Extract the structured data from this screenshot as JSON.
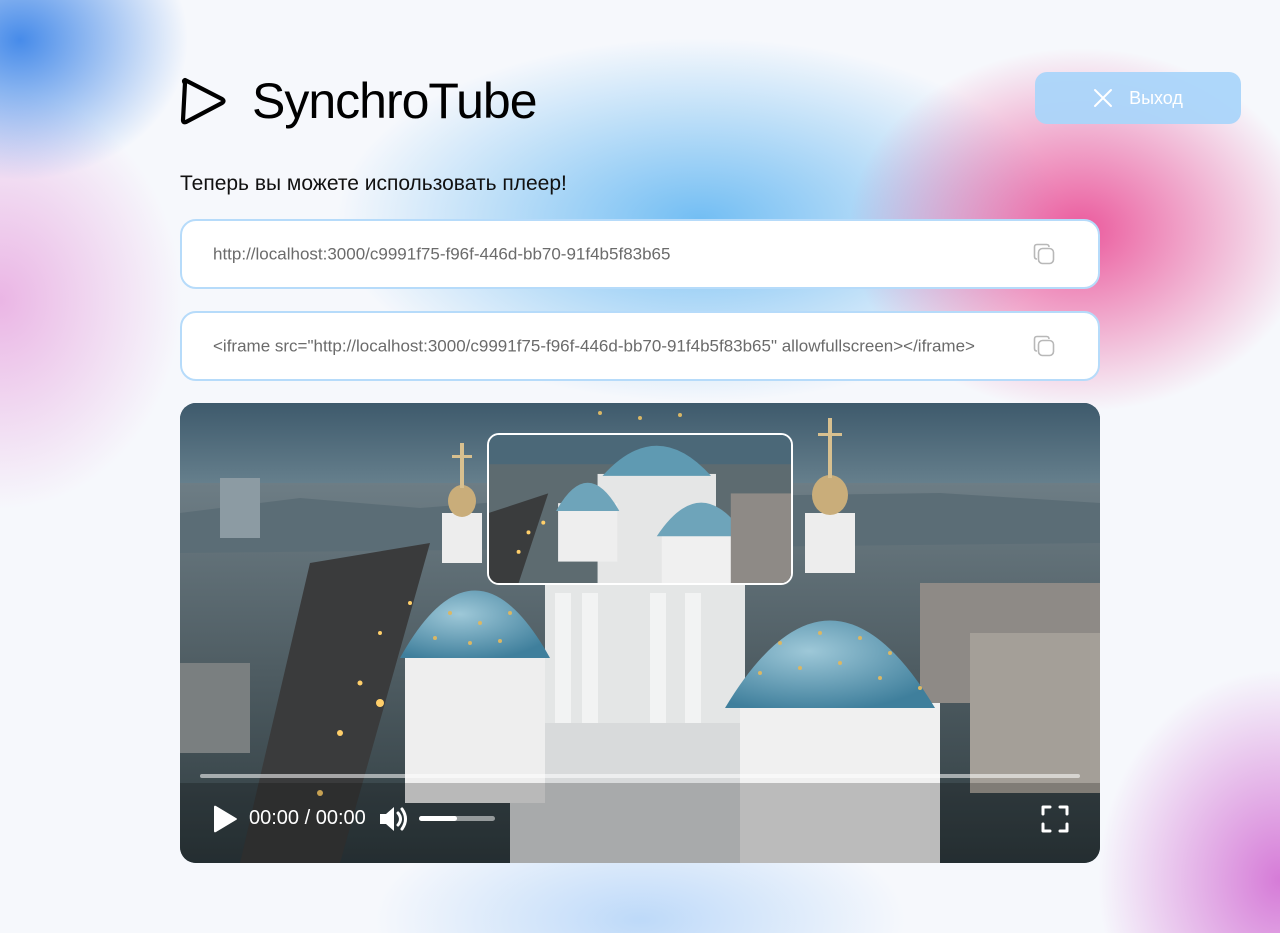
{
  "app": {
    "name": "SynchroTube",
    "logo_icon": "play-triangle-outline-icon"
  },
  "header": {
    "exit_label": "Выход",
    "exit_icon": "close-x-icon"
  },
  "main": {
    "subtitle": "Теперь вы можете использовать плеер!",
    "link_field": {
      "value": "http://localhost:3000/c9991f75-f96f-446d-bb70-91f4b5f83b65",
      "icon": "copy-icon"
    },
    "embed_field": {
      "value": "<iframe src=\"http://localhost:3000/c9991f75-f96f-446d-bb70-91f4b5f83b65\" allowfullscreen></iframe>",
      "icon": "copy-icon"
    }
  },
  "player": {
    "time": "00:00 / 00:00",
    "progress": 0,
    "volume": 0.5,
    "icons": {
      "play": "play-icon",
      "volume": "volume-icon",
      "fullscreen": "fullscreen-icon"
    }
  },
  "colors": {
    "accent": "#aad5fa",
    "field_border": "#b6dbfa",
    "text_muted": "#6b6b6b"
  }
}
